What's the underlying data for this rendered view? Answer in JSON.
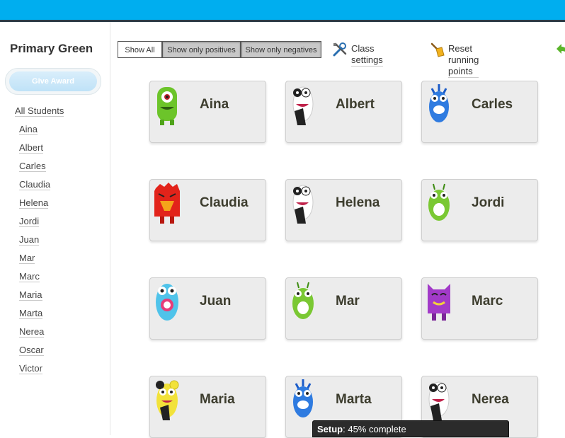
{
  "class_name": "Primary Green",
  "give_award_label": "Give Award",
  "all_students_label": "All Students",
  "sidebar_students": [
    "Aina",
    "Albert",
    "Carles",
    "Claudia",
    "Helena",
    "Jordi",
    "Juan",
    "Mar",
    "Marc",
    "Maria",
    "Marta",
    "Nerea",
    "Oscar",
    "Victor"
  ],
  "toolbar": {
    "show_all": "Show All",
    "show_positives": "Show only positives",
    "show_negatives": "Show only negatives",
    "class_settings": "Class settings",
    "reset_points": "Reset running points"
  },
  "cards": [
    {
      "name": "Aina",
      "avatar": "green-one-eyed-monster-icon"
    },
    {
      "name": "Albert",
      "avatar": "black-white-spotted-monster-icon"
    },
    {
      "name": "Carles",
      "avatar": "blue-horned-monster-icon"
    },
    {
      "name": "Claudia",
      "avatar": "red-furry-monster-icon"
    },
    {
      "name": "Helena",
      "avatar": "black-white-spotted-monster-icon"
    },
    {
      "name": "Jordi",
      "avatar": "green-antenna-monster-icon"
    },
    {
      "name": "Juan",
      "avatar": "cyan-big-mouth-monster-icon"
    },
    {
      "name": "Mar",
      "avatar": "green-antenna-monster-icon"
    },
    {
      "name": "Marc",
      "avatar": "purple-cat-monster-icon"
    },
    {
      "name": "Maria",
      "avatar": "yellow-spotted-monster-icon"
    },
    {
      "name": "Marta",
      "avatar": "blue-horned-monster-icon"
    },
    {
      "name": "Nerea",
      "avatar": "black-white-spotted-monster-icon"
    }
  ],
  "status": {
    "label": "Setup",
    "text": ": 45% complete",
    "progress_percent": 45
  },
  "colors": {
    "topbar": "#00aeef",
    "card_bg": "#ececec",
    "name_text": "#3d3d2e"
  }
}
